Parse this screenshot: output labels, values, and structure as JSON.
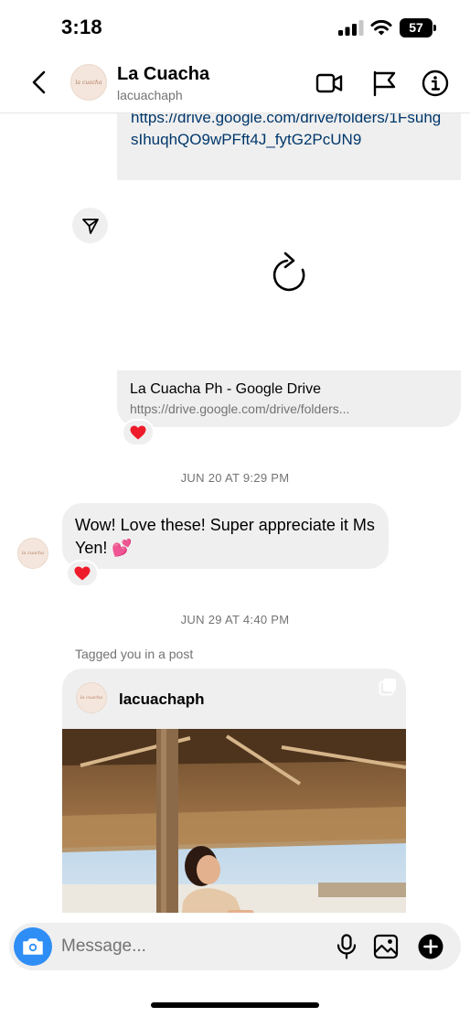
{
  "status_bar": {
    "time": "3:18",
    "battery": "57"
  },
  "header": {
    "contact_name": "La Cuacha",
    "contact_handle": "lacuachaph",
    "avatar_text": "la cuacha",
    "icons": [
      "chevron-left-icon",
      "video-camera-icon",
      "flag-icon",
      "info-icon"
    ]
  },
  "messages": {
    "link_text": "https://drive.google.com/drive/folders/1FsuhgsIhuqhQO9wPFft4J_fytG2PcUN9",
    "preview_title": "La Cuacha Ph - Google Drive",
    "preview_url": "https://drive.google.com/drive/folders...",
    "timestamp_1": "JUN 20 AT 9:29 PM",
    "message_text": "Wow! Love these! Super appreciate it Ms Yen! 💕",
    "timestamp_2": "JUN 29 AT 4:40 PM",
    "tag_label": "Tagged you in a post",
    "post_username": "lacuachaph",
    "reactions": [
      "❤️",
      "❤️"
    ]
  },
  "composer": {
    "placeholder": "Message..."
  },
  "colors": {
    "link": "#00376b",
    "bubble": "#efefef",
    "camera_button": "#2f8ef5",
    "secondary_text": "#737373"
  }
}
